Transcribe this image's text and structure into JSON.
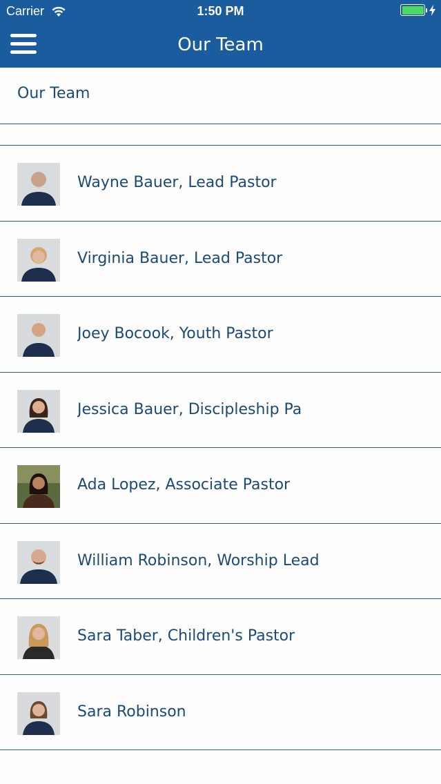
{
  "status_bar": {
    "carrier": "Carrier",
    "time": "1:50 PM",
    "battery_color": "#4cd964"
  },
  "nav": {
    "title": "Our Team",
    "menu_icon": "hamburger-menu-icon",
    "bar_color": "#1a5c9e"
  },
  "page": {
    "heading": "Our Team"
  },
  "team": [
    {
      "name": "Wayne Bauer, Lead Pastor"
    },
    {
      "name": "Virginia Bauer, Lead Pastor"
    },
    {
      "name": "Joey Bocook, Youth Pastor"
    },
    {
      "name": "Jessica Bauer, Discipleship Pa"
    },
    {
      "name": "Ada Lopez, Associate Pastor"
    },
    {
      "name": "William Robinson, Worship Lead"
    },
    {
      "name": "Sara Taber, Children's Pastor"
    },
    {
      "name": "Sara Robinson"
    }
  ]
}
